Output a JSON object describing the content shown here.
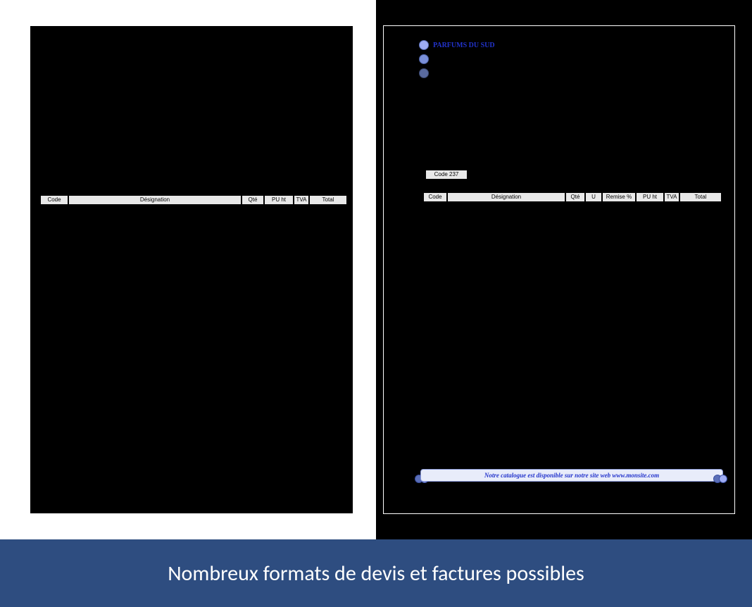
{
  "footer_caption": "Nombreux formats de devis et factures possibles",
  "left_invoice": {
    "headers": {
      "code": "Code",
      "designation": "Désignation",
      "qte": "Qté",
      "pu_ht": "PU ht",
      "tva": "TVA",
      "total": "Total"
    }
  },
  "right_invoice": {
    "company": "PARFUMS DU SUD",
    "code_box": "Code 237",
    "headers": {
      "code": "Code",
      "designation": "Désignation",
      "qte": "Qté",
      "u": "U",
      "remise": "Remise %",
      "pu_ht": "PU ht",
      "tva": "TVA",
      "total": "Total"
    },
    "promo": "Notre catalogue est disponible sur notre site web www.monsite.com"
  }
}
